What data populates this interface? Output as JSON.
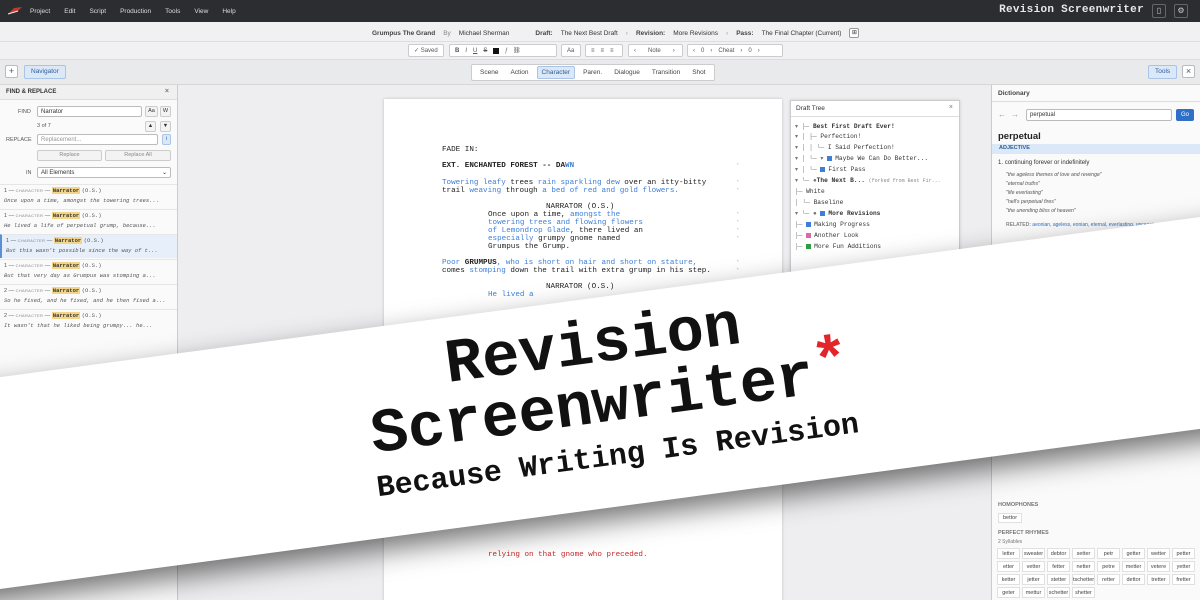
{
  "menubar": {
    "menus": [
      "Project",
      "Edit",
      "Script",
      "Production",
      "Tools",
      "View",
      "Help"
    ],
    "app_title": "Revision Screenwriter",
    "icons": [
      "app-logo",
      "bookmark-icon",
      "gear-icon"
    ]
  },
  "info": {
    "title": "Grumpus The Grand",
    "by_label": "By",
    "author": "Michael Sherman",
    "draft_label": "Draft:",
    "draft": "The Next Best Draft",
    "revision_label": "Revision:",
    "revision": "More Revisions",
    "pass_label": "Pass:",
    "pass": "The Final Chapter (Current)"
  },
  "format_toolbar": {
    "saved": "✓ Saved",
    "bold": "B",
    "italic": "I",
    "underline": "U",
    "strike": "S",
    "font_size": "Aa",
    "note_label": "Note",
    "note_count": "0",
    "cheat_label": "Cheat",
    "cheat_count": "0"
  },
  "element_bar": {
    "add": "+",
    "navigator": "Navigator",
    "tabs": [
      "Scene",
      "Action",
      "Character",
      "Paren.",
      "Dialogue",
      "Transition",
      "Shot"
    ],
    "active_tab": "Character",
    "tools": "Tools",
    "close": "×"
  },
  "find_replace": {
    "title": "FIND & REPLACE",
    "find_label": "FIND",
    "find_value": "Narrator",
    "match_count": "3 of 7",
    "case_btn": "Aa",
    "word_btn": "W",
    "replace_label": "REPLACE",
    "replace_placeholder": "Replacement...",
    "replace_btn": "Replace",
    "replace_all_btn": "Replace All",
    "in_label": "IN",
    "in_value": "All Elements",
    "results": [
      {
        "num": "1",
        "type": "CHARACTER",
        "name": "Narrator",
        "ext": "(O.S.)",
        "text": "Once upon a time, amongst the towering trees..."
      },
      {
        "num": "1",
        "type": "CHARACTER",
        "name": "Narrator",
        "ext": "(O.S.)",
        "text": "He lived a life of perpetual grump, because..."
      },
      {
        "num": "1",
        "type": "CHARACTER",
        "name": "Narrator",
        "ext": "(O.S.)",
        "text": "But this wasn't possible since the way of t..."
      },
      {
        "num": "1",
        "type": "CHARACTER",
        "name": "Narrator",
        "ext": "(O.S.)",
        "text": "But that very day as Grumpus was stomping a..."
      },
      {
        "num": "2",
        "type": "CHARACTER",
        "name": "Narrator",
        "ext": "(O.S.)",
        "text": "So he fixed, and he fixed, and he then fixed a..."
      },
      {
        "num": "2",
        "type": "CHARACTER",
        "name": "Narrator",
        "ext": "(O.S.)",
        "text": "It wasn't that he liked being grumpy... he..."
      }
    ]
  },
  "script": {
    "fade_in": "FADE IN:",
    "scene_heading_a": "EXT. ENCHANTED FOREST -- DA",
    "scene_heading_b": "WN",
    "action1_l1": [
      "Towering leafy",
      " trees ",
      "rain sparkling dew",
      " over an itty-bitty"
    ],
    "action1_l2": [
      "trail ",
      "weaving",
      " through ",
      "a bed of red and gold flowers."
    ],
    "character1": "NARRATOR (O.S.)",
    "dialogue1": [
      "Once upon a time, ",
      "amongst the"
    ],
    "dialogue2": "towering trees and flowing flowers",
    "dialogue3": [
      "of Lemondrop Glade",
      ", there lived an"
    ],
    "dialogue4": [
      "especially",
      " grumpy gnome named"
    ],
    "dialogue5": "Grumpus the Grump.",
    "action2_l1": [
      "Poor ",
      "GRUMPUS",
      ", ",
      "who is short on hair and short on stature,"
    ],
    "action2_l2": [
      "comes ",
      "stomping",
      " down the trail with extra grump in his step."
    ],
    "character2": "NARRATOR (O.S.)",
    "dialogue6": "He lived a",
    "dialogue_bottom": "relying on that gnome who preceded."
  },
  "draft_tree": {
    "title": "Draft Tree",
    "close": "×",
    "nodes": [
      "Best First Draft Ever!",
      "Perfection!",
      "I Said Perfection!",
      "Maybe We Can Do Better...",
      "First Pass",
      "The Next B...",
      "(forked from Best Fir...",
      "White",
      "Baseline",
      "More Revisions",
      "Making Progress",
      "Another Look",
      "More Fun Additions"
    ]
  },
  "dictionary": {
    "title": "Dictionary",
    "search_value": "perpetual",
    "go": "Go",
    "word": "perpetual",
    "pos": "ADJECTIVE",
    "def_num": "1.",
    "definition": "continuing forever or indefinitely",
    "examples": [
      "\"the ageless themes of love and revenge\"",
      "\"eternal truths\"",
      "\"life everlasting\"",
      "\"hell's perpetual fires\"",
      "\"the unending bliss of heaven\""
    ],
    "related_label": "RELATED:",
    "related": "aeonian, ageless, eonian, eternal, everlasting, unceasing",
    "homophones_label": "HOMOPHONES",
    "homophone": "bettor",
    "rhymes_label": "PERFECT RHYMES",
    "syllables": "2 Syllables",
    "rhymes": [
      "letter",
      "sweater",
      "debtor",
      "setter",
      "petr",
      "getter",
      "wetter",
      "petter",
      "etter",
      "vetter",
      "fetter",
      "netter",
      "petre",
      "metter",
      "vetere",
      "yetter",
      "ketter",
      "jetter",
      "stetter",
      "tschetter",
      "retter",
      "dettor",
      "tretter",
      "fretter",
      "geter",
      "mettur",
      "schetter",
      "shetter"
    ]
  },
  "banner": {
    "line1": "Revision",
    "line2": "Screenwriter",
    "asterisk": "*",
    "tagline": "Because Writing Is Revision"
  },
  "colors": {
    "accent": "#3d7fd8",
    "revision_red": "#c62828",
    "highlight": "#f3d58a",
    "banner_asterisk": "#e3242b"
  }
}
